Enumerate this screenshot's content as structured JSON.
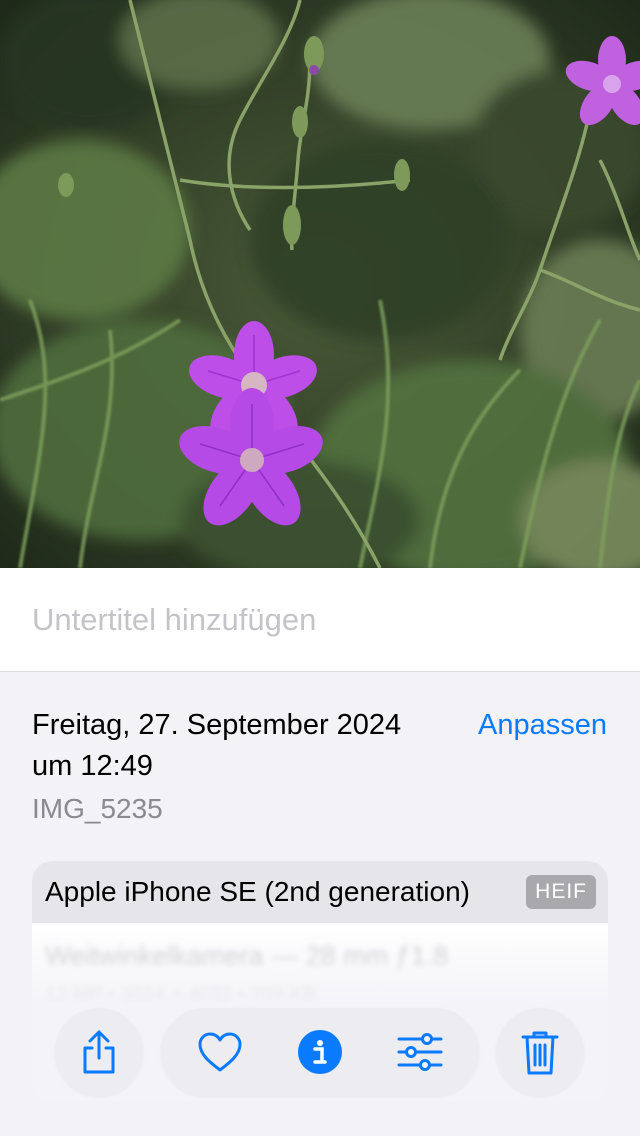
{
  "photo": {
    "subject": "flower-photo"
  },
  "caption": {
    "placeholder": "Untertitel hinzufügen",
    "value": ""
  },
  "info": {
    "date_line1": "Freitag, 27. September 2024",
    "date_line2": "um 12:49",
    "adjust_label": "Anpassen",
    "filename": "IMG_5235",
    "device": "Apple iPhone SE (2nd generation)",
    "format_badge": "HEIF",
    "lens": "Weitwinkelkamera — 28 mm ƒ1.8",
    "specs": "12 MP  •  3024 × 4032  •  709 KB"
  },
  "toolbar": {
    "share": "share-icon",
    "favorite": "heart-icon",
    "info": "info-icon",
    "edit": "sliders-icon",
    "delete": "trash-icon"
  },
  "colors": {
    "accent": "#0a7aff",
    "background": "#f2f2f7",
    "badge": "#a8a8ad"
  }
}
